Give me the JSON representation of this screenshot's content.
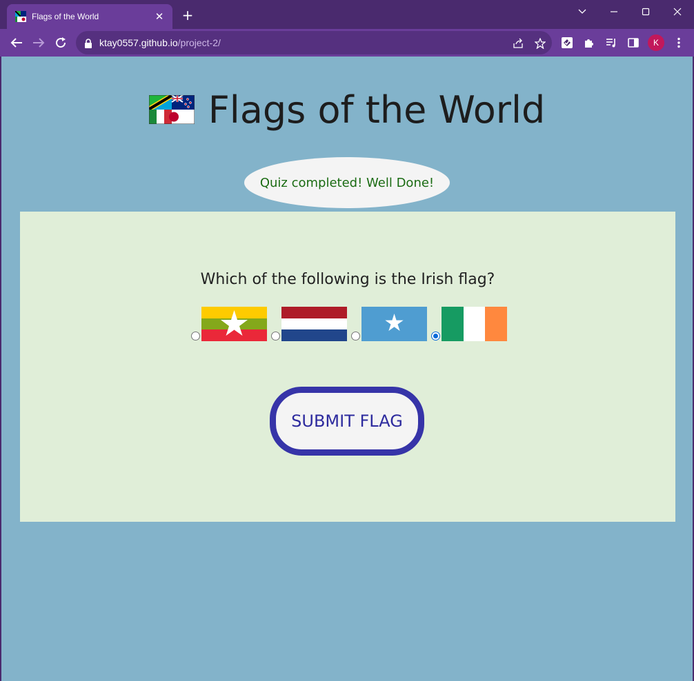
{
  "browser": {
    "tab_title": "Flags of the World",
    "tab_close": "✕",
    "new_tab": "+",
    "url_host": "ktay0557.github.io",
    "url_path": "/project-2/",
    "profile_initial": "K"
  },
  "colors": {
    "frame": "#4a2a6e",
    "toolbar": "#6a3d9a",
    "page_background": "#83b3ca",
    "quiz_background": "#e0eed8",
    "score_text": "#1a6b12",
    "submit_border": "#3634a8",
    "radio_checked": "#0b6bd8"
  },
  "page": {
    "title": "Flags of the World",
    "score_message": "Quiz completed! Well Done!"
  },
  "quiz": {
    "question": "Which of the following is the Irish flag?",
    "options": [
      {
        "flag": "myanmar-flag",
        "selected": false
      },
      {
        "flag": "netherlands-flag",
        "selected": false
      },
      {
        "flag": "somalia-flag",
        "selected": false
      },
      {
        "flag": "ireland-flag",
        "selected": true
      }
    ],
    "submit_label": "SUBMIT FLAG"
  }
}
